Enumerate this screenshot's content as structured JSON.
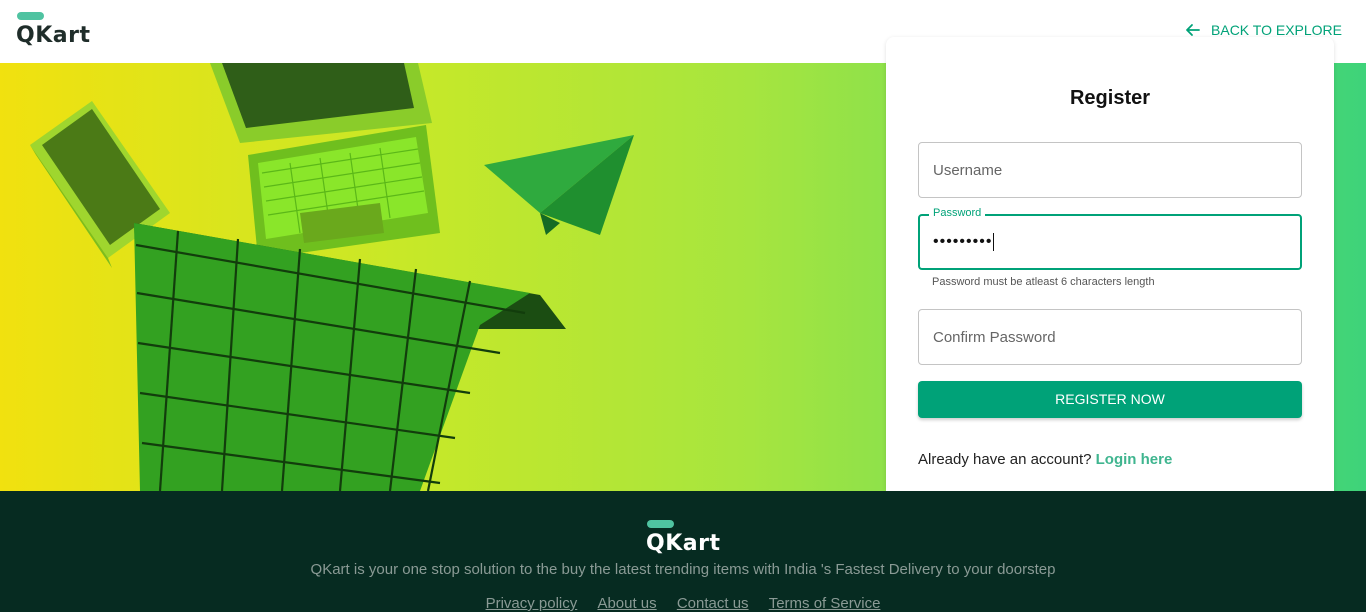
{
  "header": {
    "logo_text": "QKart",
    "back_link": "BACK TO EXPLORE"
  },
  "register": {
    "title": "Register",
    "username_placeholder": "Username",
    "password_label": "Password",
    "password_value": "•••••••••",
    "password_helper": "Password must be atleast 6 characters length",
    "confirm_placeholder": "Confirm Password",
    "submit_label": "REGISTER NOW",
    "login_prompt": "Already have an account?",
    "login_link": "Login here"
  },
  "footer": {
    "logo_text": "QKart",
    "tagline": "QKart is your one stop solution to the buy the latest trending items with India 's Fastest Delivery to your doorstep",
    "links": [
      "Privacy policy",
      "About us",
      "Contact us",
      "Terms of Service"
    ]
  },
  "colors": {
    "accent": "#00a278",
    "footer_bg": "#062b21",
    "logo_pill": "#4fc3a1"
  }
}
